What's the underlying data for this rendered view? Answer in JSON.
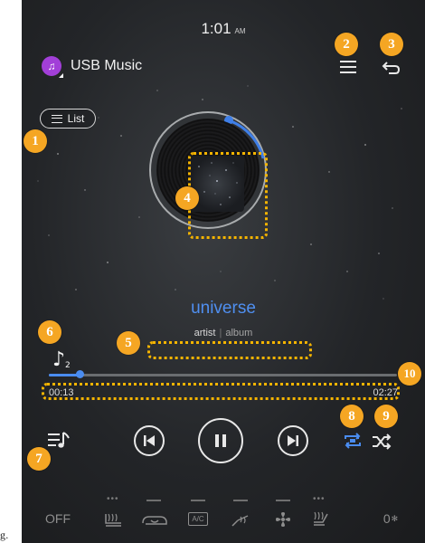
{
  "caption_fragment": "g.",
  "status": {
    "time": "1:01",
    "ampm": "AM"
  },
  "source": {
    "label": "USB Music",
    "icon": "music-note-icon"
  },
  "list_button": {
    "label": "List"
  },
  "track": {
    "title": "universe",
    "artist": "artist",
    "album": "album",
    "elapsed": "00:13",
    "duration": "02:27",
    "progress": 0.088
  },
  "controls": {
    "queue_icon": "playlist-music-icon",
    "prev_icon": "skip-previous-icon",
    "play_pause_icon": "pause-icon",
    "next_icon": "skip-next-icon",
    "repeat_icon": "repeat-one-icon",
    "shuffle_icon": "shuffle-icon"
  },
  "climate": {
    "off_label": "OFF",
    "ac_label": "A/C",
    "fan_level": "0",
    "icons": [
      "rear-heated-seat-icon",
      "recirculation-icon",
      "ac-icon",
      "defrost-icon",
      "fan-icon",
      "heated-seat-icon"
    ]
  },
  "annotations": [
    "1",
    "2",
    "3",
    "4",
    "5",
    "6",
    "7",
    "8",
    "9",
    "10"
  ],
  "colors": {
    "accent": "#4a8cf0",
    "annotation": "#f5a623",
    "source_icon": "#a23fd8"
  }
}
